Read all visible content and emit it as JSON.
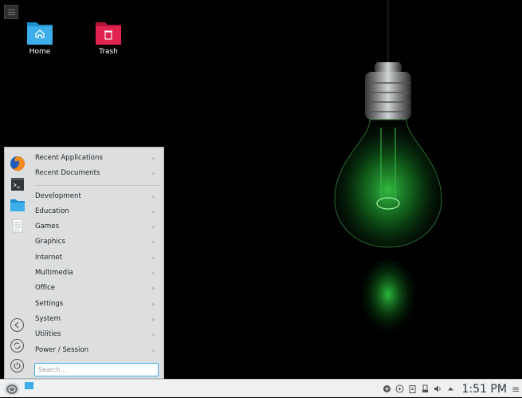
{
  "desktop": {
    "icons": [
      {
        "label": "Home",
        "icon": "home-folder-icon"
      },
      {
        "label": "Trash",
        "icon": "trash-folder-icon"
      }
    ]
  },
  "menu": {
    "favorites": [
      "firefox-icon",
      "terminal-icon",
      "file-manager-icon",
      "text-editor-icon"
    ],
    "items": [
      {
        "label": "Recent Applications"
      },
      {
        "label": "Recent Documents"
      },
      {
        "label": "Development"
      },
      {
        "label": "Education"
      },
      {
        "label": "Games"
      },
      {
        "label": "Graphics"
      },
      {
        "label": "Internet"
      },
      {
        "label": "Multimedia"
      },
      {
        "label": "Office"
      },
      {
        "label": "Settings"
      },
      {
        "label": "System"
      },
      {
        "label": "Utilities"
      },
      {
        "label": "Power / Session"
      }
    ],
    "search": {
      "placeholder": "Search..."
    },
    "side_actions": [
      "back-icon",
      "refresh-icon",
      "power-icon"
    ]
  },
  "panel": {
    "clock": "1:51 PM",
    "tray_icons": [
      "network-icon",
      "media-icon",
      "clipboard-icon",
      "devices-icon",
      "volume-icon",
      "expand-tray-icon"
    ],
    "colors": {
      "accent": "#3daee9",
      "panel_bg": "#eff0f1",
      "menu_bg": "#dcdee0"
    }
  }
}
